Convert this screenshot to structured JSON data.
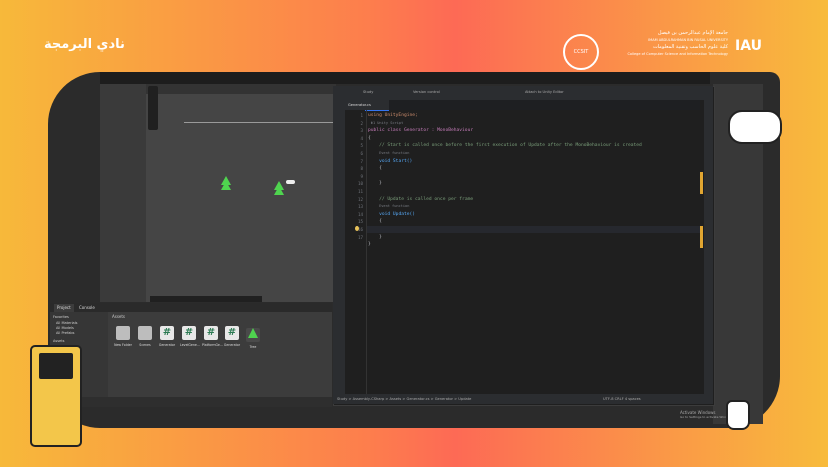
{
  "branding": {
    "left_logo": "نادي البرمجة",
    "university_ar": "جامعة الإمام عبدالرحمن بن فيصل",
    "university_en": "IMAM ABDULRAHMAN BIN FAISAL UNIVERSITY",
    "college_ar": "كلية علوم الحاسب وتقنية المعلومات",
    "college_en": "College of Computer Science and Information Technology",
    "badge": "CCSIT",
    "iau": "IAU"
  },
  "unity": {
    "tabs": [
      "Project",
      "Console"
    ],
    "favorites_label": "Favorites",
    "favorites": [
      "All Materials",
      "All Models",
      "All Prefabs"
    ],
    "assets_label": "Assets",
    "assets_path": "Assets",
    "assets": [
      {
        "label": "New Folder",
        "type": "folder"
      },
      {
        "label": "Scenes",
        "type": "folder"
      },
      {
        "label": "Generator",
        "type": "script"
      },
      {
        "label": "LevelGene...",
        "type": "script"
      },
      {
        "label": "PlatformGe...",
        "type": "script"
      },
      {
        "label": "Generator",
        "type": "script"
      },
      {
        "label": "Tree",
        "type": "tree"
      }
    ],
    "console_bottom": "Inspector",
    "activate_windows": "Activate Windows",
    "activate_hint": "Go to Settings to activate Windows."
  },
  "vscode": {
    "tab_label": "Generator.cs",
    "project_title": "Study",
    "branch": "Version control",
    "config": "Attach to Unity Editor",
    "line_numbers": [
      "1",
      "2",
      "3",
      "4",
      "5",
      "6",
      "7",
      "8",
      "9",
      "10",
      "11",
      "12",
      "13",
      "14",
      "15",
      "16",
      "17"
    ],
    "code": {
      "l1": "using UnityEngine;",
      "l3_hint": "Φ1 Unity Script",
      "l3": "public class Generator : MonoBehaviour",
      "l4": "{",
      "l5": "// Start is called once before the first execution of Update after the MonoBehaviour is created",
      "l5_hint": "Event function",
      "l6": "void Start()",
      "l7": "{",
      "l9": "}",
      "l11": "// Update is called once per frame",
      "l11_hint": "Event function",
      "l12": "void Update()",
      "l13": "{",
      "l15": "}",
      "l16": "}"
    },
    "status": "Study > Assembly-CSharp > Assets > Generator.cs > Generator > Update",
    "status_right": "UTF-8  CRLF  4 spaces"
  }
}
